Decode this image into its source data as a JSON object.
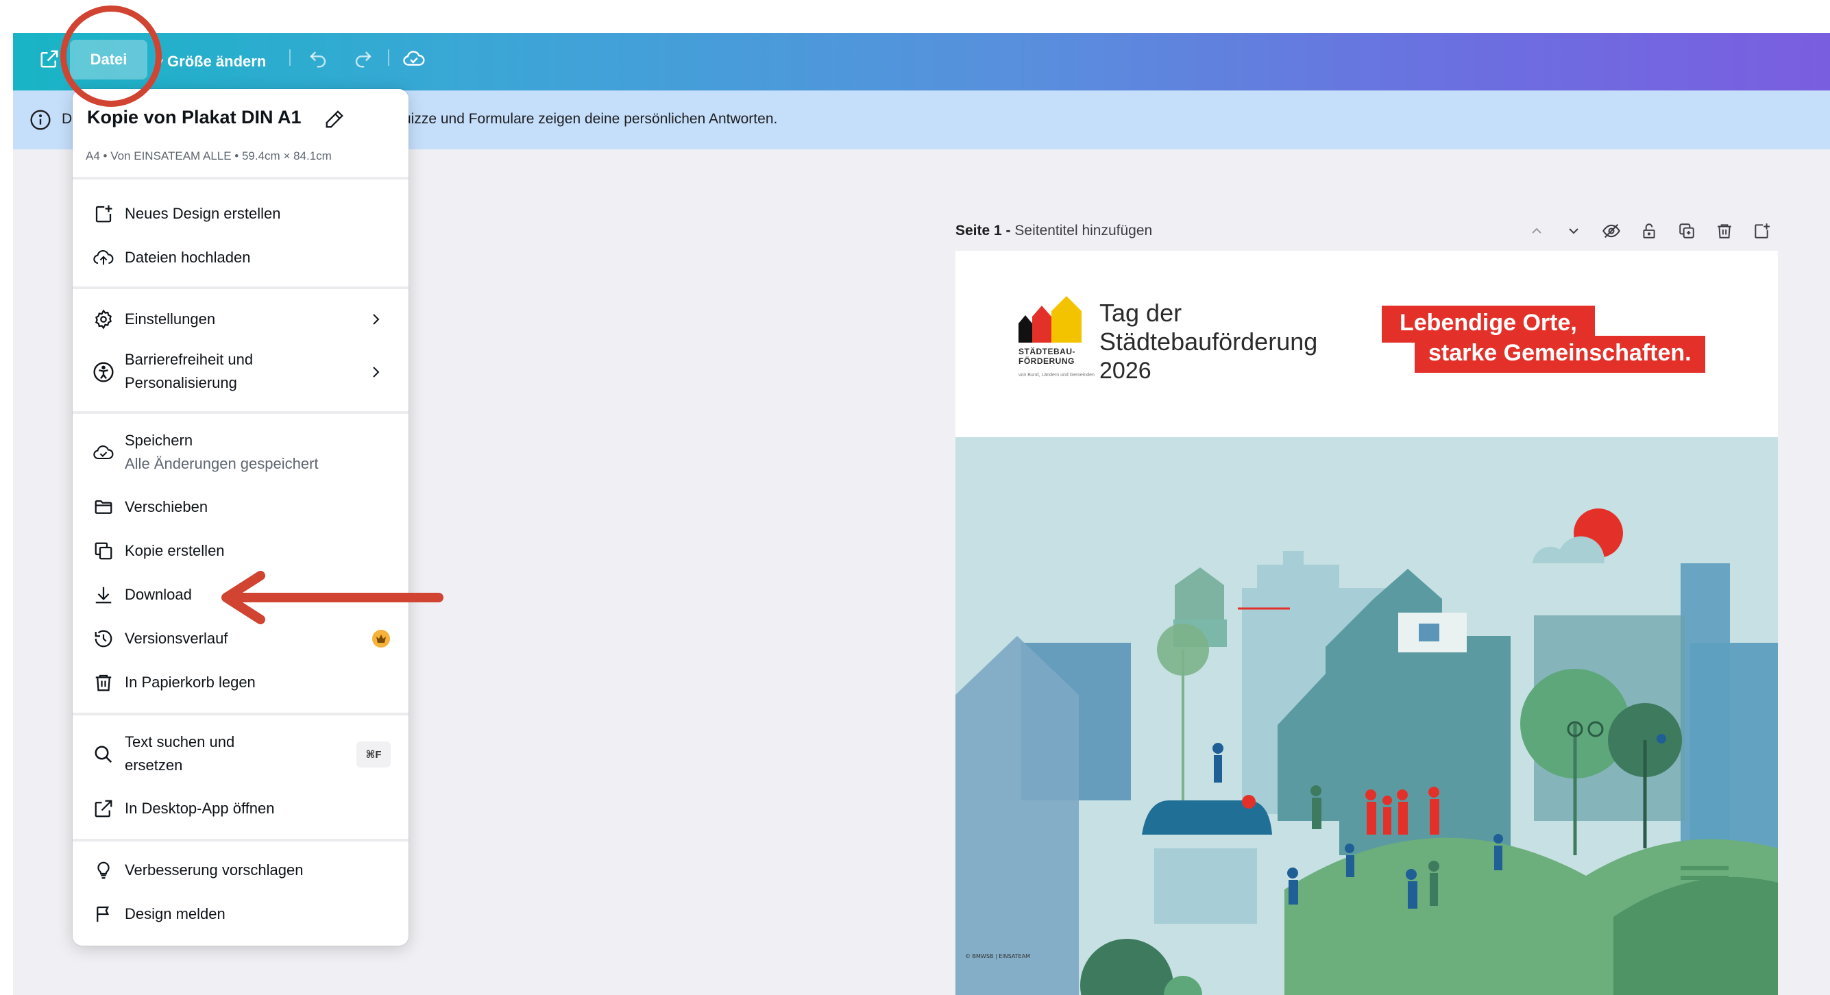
{
  "toolbar": {
    "file_label": "Datei",
    "resize_label": "Größe ändern"
  },
  "banner": {
    "prefix": "D",
    "text": "uizze und Formulare zeigen deine persönlichen Antworten."
  },
  "file_menu": {
    "title": "Kopie von Plakat DIN A1",
    "subtitle": "A4 • Von EINSATEAM ALLE • 59.4cm × 84.1cm",
    "items": [
      {
        "label": "Neues Design erstellen"
      },
      {
        "label": "Dateien hochladen"
      },
      {
        "label": "Einstellungen"
      },
      {
        "label": "Barrierefreiheit und",
        "label2": "Personalisierung"
      },
      {
        "label": "Speichern",
        "sub": "Alle Änderungen gespeichert"
      },
      {
        "label": "Verschieben"
      },
      {
        "label": "Kopie erstellen"
      },
      {
        "label": "Download"
      },
      {
        "label": "Versionsverlauf"
      },
      {
        "label": "In Papierkorb legen"
      },
      {
        "label": "Text suchen und",
        "label2": "ersetzen",
        "shortcut": "⌘F"
      },
      {
        "label": "In Desktop-App öffnen"
      },
      {
        "label": "Verbesserung vorschlagen"
      },
      {
        "label": "Design melden"
      }
    ]
  },
  "page": {
    "number_label": "Seite 1 -",
    "title_placeholder": "Seitentitel hinzufügen"
  },
  "poster": {
    "title_line1": "Tag der",
    "title_line2": "Städtebauförderung",
    "year": "2026",
    "logo_line1": "STÄDTEBAU-",
    "logo_line2": "FÖRDERUNG",
    "logo_tiny": "von Bund, Ländern und Gemeinden",
    "slogan_line1": "Lebendige Orte,",
    "slogan_line2": "starke Gemeinschaften.",
    "credit": "© BMWSB | EINSATEAM"
  },
  "colors": {
    "accent_red": "#e3312a",
    "annotation_red": "#d04431",
    "banner_bg": "#c5dffb"
  }
}
